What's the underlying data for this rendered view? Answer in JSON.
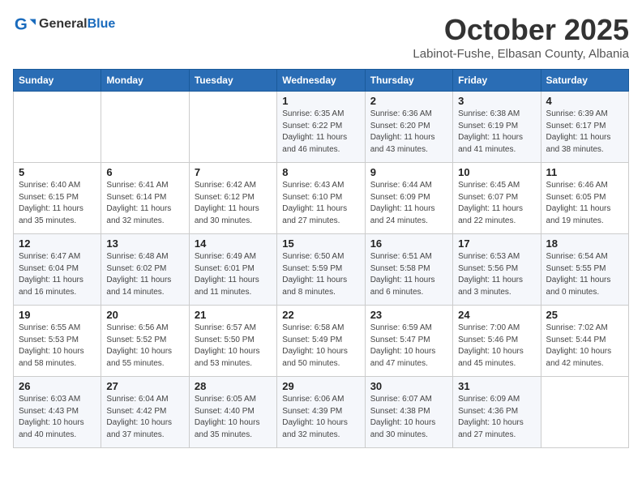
{
  "logo": {
    "general": "General",
    "blue": "Blue"
  },
  "title": "October 2025",
  "location": "Labinot-Fushe, Elbasan County, Albania",
  "headers": [
    "Sunday",
    "Monday",
    "Tuesday",
    "Wednesday",
    "Thursday",
    "Friday",
    "Saturday"
  ],
  "weeks": [
    [
      {
        "day": "",
        "info": ""
      },
      {
        "day": "",
        "info": ""
      },
      {
        "day": "",
        "info": ""
      },
      {
        "day": "1",
        "info": "Sunrise: 6:35 AM\nSunset: 6:22 PM\nDaylight: 11 hours\nand 46 minutes."
      },
      {
        "day": "2",
        "info": "Sunrise: 6:36 AM\nSunset: 6:20 PM\nDaylight: 11 hours\nand 43 minutes."
      },
      {
        "day": "3",
        "info": "Sunrise: 6:38 AM\nSunset: 6:19 PM\nDaylight: 11 hours\nand 41 minutes."
      },
      {
        "day": "4",
        "info": "Sunrise: 6:39 AM\nSunset: 6:17 PM\nDaylight: 11 hours\nand 38 minutes."
      }
    ],
    [
      {
        "day": "5",
        "info": "Sunrise: 6:40 AM\nSunset: 6:15 PM\nDaylight: 11 hours\nand 35 minutes."
      },
      {
        "day": "6",
        "info": "Sunrise: 6:41 AM\nSunset: 6:14 PM\nDaylight: 11 hours\nand 32 minutes."
      },
      {
        "day": "7",
        "info": "Sunrise: 6:42 AM\nSunset: 6:12 PM\nDaylight: 11 hours\nand 30 minutes."
      },
      {
        "day": "8",
        "info": "Sunrise: 6:43 AM\nSunset: 6:10 PM\nDaylight: 11 hours\nand 27 minutes."
      },
      {
        "day": "9",
        "info": "Sunrise: 6:44 AM\nSunset: 6:09 PM\nDaylight: 11 hours\nand 24 minutes."
      },
      {
        "day": "10",
        "info": "Sunrise: 6:45 AM\nSunset: 6:07 PM\nDaylight: 11 hours\nand 22 minutes."
      },
      {
        "day": "11",
        "info": "Sunrise: 6:46 AM\nSunset: 6:05 PM\nDaylight: 11 hours\nand 19 minutes."
      }
    ],
    [
      {
        "day": "12",
        "info": "Sunrise: 6:47 AM\nSunset: 6:04 PM\nDaylight: 11 hours\nand 16 minutes."
      },
      {
        "day": "13",
        "info": "Sunrise: 6:48 AM\nSunset: 6:02 PM\nDaylight: 11 hours\nand 14 minutes."
      },
      {
        "day": "14",
        "info": "Sunrise: 6:49 AM\nSunset: 6:01 PM\nDaylight: 11 hours\nand 11 minutes."
      },
      {
        "day": "15",
        "info": "Sunrise: 6:50 AM\nSunset: 5:59 PM\nDaylight: 11 hours\nand 8 minutes."
      },
      {
        "day": "16",
        "info": "Sunrise: 6:51 AM\nSunset: 5:58 PM\nDaylight: 11 hours\nand 6 minutes."
      },
      {
        "day": "17",
        "info": "Sunrise: 6:53 AM\nSunset: 5:56 PM\nDaylight: 11 hours\nand 3 minutes."
      },
      {
        "day": "18",
        "info": "Sunrise: 6:54 AM\nSunset: 5:55 PM\nDaylight: 11 hours\nand 0 minutes."
      }
    ],
    [
      {
        "day": "19",
        "info": "Sunrise: 6:55 AM\nSunset: 5:53 PM\nDaylight: 10 hours\nand 58 minutes."
      },
      {
        "day": "20",
        "info": "Sunrise: 6:56 AM\nSunset: 5:52 PM\nDaylight: 10 hours\nand 55 minutes."
      },
      {
        "day": "21",
        "info": "Sunrise: 6:57 AM\nSunset: 5:50 PM\nDaylight: 10 hours\nand 53 minutes."
      },
      {
        "day": "22",
        "info": "Sunrise: 6:58 AM\nSunset: 5:49 PM\nDaylight: 10 hours\nand 50 minutes."
      },
      {
        "day": "23",
        "info": "Sunrise: 6:59 AM\nSunset: 5:47 PM\nDaylight: 10 hours\nand 47 minutes."
      },
      {
        "day": "24",
        "info": "Sunrise: 7:00 AM\nSunset: 5:46 PM\nDaylight: 10 hours\nand 45 minutes."
      },
      {
        "day": "25",
        "info": "Sunrise: 7:02 AM\nSunset: 5:44 PM\nDaylight: 10 hours\nand 42 minutes."
      }
    ],
    [
      {
        "day": "26",
        "info": "Sunrise: 6:03 AM\nSunset: 4:43 PM\nDaylight: 10 hours\nand 40 minutes."
      },
      {
        "day": "27",
        "info": "Sunrise: 6:04 AM\nSunset: 4:42 PM\nDaylight: 10 hours\nand 37 minutes."
      },
      {
        "day": "28",
        "info": "Sunrise: 6:05 AM\nSunset: 4:40 PM\nDaylight: 10 hours\nand 35 minutes."
      },
      {
        "day": "29",
        "info": "Sunrise: 6:06 AM\nSunset: 4:39 PM\nDaylight: 10 hours\nand 32 minutes."
      },
      {
        "day": "30",
        "info": "Sunrise: 6:07 AM\nSunset: 4:38 PM\nDaylight: 10 hours\nand 30 minutes."
      },
      {
        "day": "31",
        "info": "Sunrise: 6:09 AM\nSunset: 4:36 PM\nDaylight: 10 hours\nand 27 minutes."
      },
      {
        "day": "",
        "info": ""
      }
    ]
  ]
}
